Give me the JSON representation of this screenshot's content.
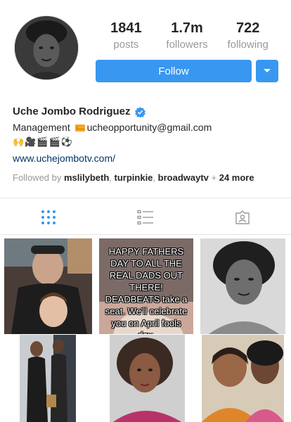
{
  "profile": {
    "posts_count": "1841",
    "posts_label": "posts",
    "followers_count": "1.7m",
    "followers_label": "followers",
    "following_count": "722",
    "following_label": "following",
    "follow_button": "Follow",
    "name": "Uche Jombo Rodriguez",
    "bio_line1_prefix": "Management ",
    "bio_email": "ucheopportunity@gmail.com",
    "bio_emojis": "🙌🎥🎬🎬⚽",
    "bio_link": "www.uchejombotv.com/",
    "followed_by_prefix": "Followed by ",
    "followed_by_users": [
      "mslilybeth",
      "turpinkie",
      "broadwaytv"
    ],
    "followed_by_more": "24 more"
  },
  "posts": [
    {
      "caption": ""
    },
    {
      "caption": "HAPPY FATHERS DAY TO ALL THE REAL DADS OUT THERE! DEADBEATS take a seat. We'll celebrate you on April fools day."
    },
    {
      "caption": ""
    },
    {
      "caption": ""
    },
    {
      "caption": ""
    },
    {
      "caption": ""
    }
  ],
  "colors": {
    "accent": "#3897f0",
    "muted": "#999999",
    "text": "#262626",
    "link": "#003569",
    "verified": "#3897f0"
  },
  "icons": {
    "grid_tab": "grid-icon",
    "list_tab": "list-icon",
    "tagged_tab": "tagged-icon",
    "dropdown": "caret-down-icon",
    "verified": "verified-badge-icon"
  }
}
